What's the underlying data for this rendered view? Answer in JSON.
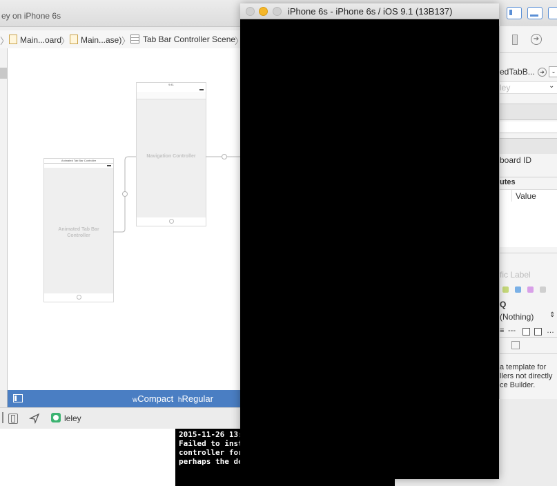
{
  "xcode": {
    "title_fragment": "ey on iPhone 6s",
    "breadcrumbs": [
      "Main...oard",
      "Main...ase)",
      "Tab Bar Controller Scene"
    ]
  },
  "storyboard": {
    "tab_scene": {
      "header": "Animated Tab Bar Controller",
      "label": "Animated Tab Bar Controller"
    },
    "nav_scene": {
      "header": "9:41",
      "label": "Navigation Controller"
    }
  },
  "size_class": {
    "w_prefix": "w",
    "w_value": "Compact",
    "h_prefix": "h",
    "h_value": "Regular"
  },
  "debug_bar": {
    "target_name": "leley"
  },
  "console": {
    "lines": [
      "2015-11-26 13:",
      "Failed to inst",
      "controller for",
      "perhaps the de"
    ]
  },
  "simulator": {
    "title": "iPhone 6s - iPhone 6s / iOS 9.1 (13B137)",
    "colors": {
      "close": "#d0d0d0",
      "minimize": "#f5b72a",
      "zoom": "#d0d0d0"
    }
  },
  "inspector": {
    "class_field": "edTabB...",
    "module_field": "ley",
    "storyboard_id_label": "board ID",
    "attributes_header": "utes",
    "attributes_value_col": "Value",
    "label_placeholder": "fic Label",
    "color_swatches": [
      "#c6d97a",
      "#7ab0e6",
      "#d8a0e8",
      "#cfcfcf"
    ],
    "section_char": "Q",
    "nothing_select": "(Nothing)",
    "line_end_fragment": "---",
    "help_lines": [
      "a template for",
      "llers not directly",
      "ce Builder."
    ]
  }
}
